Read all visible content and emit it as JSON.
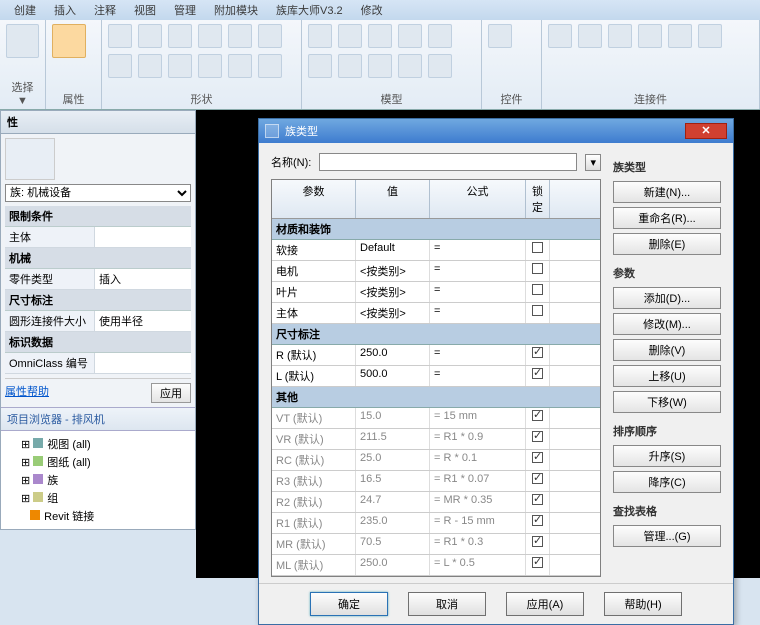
{
  "menu": {
    "items": [
      "创建",
      "插入",
      "注释",
      "视图",
      "管理",
      "附加模块",
      "族库大师V3.2",
      "修改"
    ]
  },
  "ribbon": {
    "groups": [
      {
        "label": "选择 ▼"
      },
      {
        "label": "属性"
      },
      {
        "label": "形状"
      },
      {
        "label": "模型"
      },
      {
        "label": "控件"
      },
      {
        "label": "连接件"
      }
    ]
  },
  "props": {
    "header": "性",
    "category_label": "族: 机械设备",
    "constraint_section": "限制条件",
    "rows": [
      {
        "k": "主体",
        "v": ""
      },
      {
        "k": "机械",
        "v": "",
        "section": true
      },
      {
        "k": "零件类型",
        "v": "插入"
      },
      {
        "k": "尺寸标注",
        "v": "",
        "section": true
      },
      {
        "k": "圆形连接件大小",
        "v": "使用半径"
      },
      {
        "k": "标识数据",
        "v": "",
        "section": true
      },
      {
        "k": "OmniClass 编号",
        "v": ""
      }
    ],
    "help_link": "属性帮助",
    "apply_btn": "应用",
    "breadcrumb": "项目浏览器 - 排风机",
    "tree": [
      "视图 (all)",
      "图纸 (all)",
      "族",
      "组",
      "Revit 链接"
    ]
  },
  "dialog": {
    "title": "族类型",
    "name_label": "名称(N):",
    "name_value": "",
    "headers": {
      "param": "参数",
      "value": "值",
      "formula": "公式",
      "lock": "锁定"
    },
    "groups": [
      {
        "name": "材质和装饰",
        "rows": [
          {
            "p": "软接",
            "v": "Default",
            "f": "=",
            "lock": false,
            "gray": false
          },
          {
            "p": "电机",
            "v": "<按类别>",
            "f": "=",
            "lock": false,
            "gray": false
          },
          {
            "p": "叶片",
            "v": "<按类别>",
            "f": "=",
            "lock": false,
            "gray": false
          },
          {
            "p": "主体",
            "v": "<按类别>",
            "f": "=",
            "lock": false,
            "gray": false
          }
        ]
      },
      {
        "name": "尺寸标注",
        "rows": [
          {
            "p": "R (默认)",
            "v": "250.0",
            "f": "=",
            "lock": true,
            "gray": false
          },
          {
            "p": "L (默认)",
            "v": "500.0",
            "f": "=",
            "lock": true,
            "gray": false
          }
        ]
      },
      {
        "name": "其他",
        "rows": [
          {
            "p": "VT (默认)",
            "v": "15.0",
            "f": "= 15 mm",
            "lock": true,
            "gray": true
          },
          {
            "p": "VR (默认)",
            "v": "211.5",
            "f": "= R1 * 0.9",
            "lock": true,
            "gray": true
          },
          {
            "p": "RC (默认)",
            "v": "25.0",
            "f": "= R * 0.1",
            "lock": true,
            "gray": true
          },
          {
            "p": "R3 (默认)",
            "v": "16.5",
            "f": "= R1 * 0.07",
            "lock": true,
            "gray": true
          },
          {
            "p": "R2 (默认)",
            "v": "24.7",
            "f": "= MR * 0.35",
            "lock": true,
            "gray": true
          },
          {
            "p": "R1 (默认)",
            "v": "235.0",
            "f": "= R - 15 mm",
            "lock": true,
            "gray": true
          },
          {
            "p": "MR (默认)",
            "v": "70.5",
            "f": "= R1 * 0.3",
            "lock": true,
            "gray": true
          },
          {
            "p": "ML (默认)",
            "v": "250.0",
            "f": "= L * 0.5",
            "lock": true,
            "gray": true
          }
        ]
      }
    ],
    "side": {
      "s1": "族类型",
      "s1_buttons": [
        "新建(N)...",
        "重命名(R)...",
        "删除(E)"
      ],
      "s2": "参数",
      "s2_buttons": [
        "添加(D)...",
        "修改(M)...",
        "删除(V)",
        "上移(U)",
        "下移(W)"
      ],
      "s3": "排序顺序",
      "s3_buttons": [
        "升序(S)",
        "降序(C)"
      ],
      "s4": "查找表格",
      "s4_buttons": [
        "管理...(G)"
      ]
    },
    "footer": {
      "ok": "确定",
      "cancel": "取消",
      "apply": "应用(A)",
      "help": "帮助(H)"
    }
  }
}
